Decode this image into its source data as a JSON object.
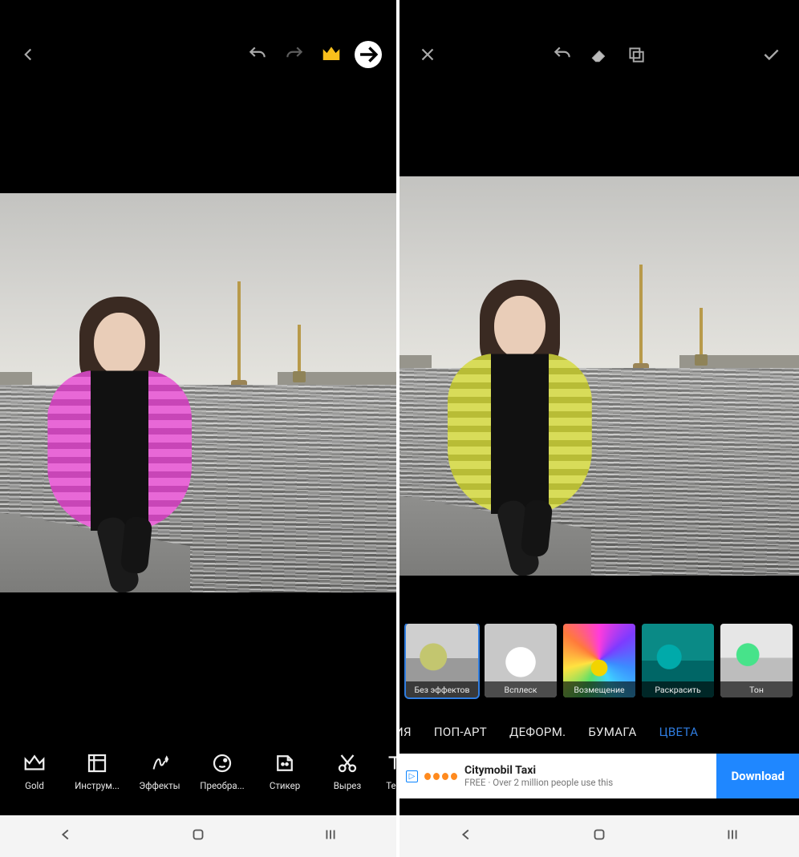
{
  "left": {
    "toolbar": {
      "back": "back",
      "undo": "undo",
      "redo": "redo",
      "crown": "crown",
      "next": "next"
    },
    "tools": [
      {
        "key": "gold",
        "label": "Gold"
      },
      {
        "key": "tools",
        "label": "Инструм..."
      },
      {
        "key": "effects",
        "label": "Эффекты"
      },
      {
        "key": "transform",
        "label": "Преобра..."
      },
      {
        "key": "sticker",
        "label": "Стикер"
      },
      {
        "key": "cutout",
        "label": "Вырез"
      },
      {
        "key": "text",
        "label": "Те..."
      }
    ]
  },
  "right": {
    "toolbar": {
      "close": "close",
      "undo": "undo",
      "eraser": "eraser",
      "layers": "layers",
      "apply": "apply"
    },
    "effects": [
      {
        "key": "none",
        "label": "Без эффектов",
        "selected": true
      },
      {
        "key": "splash",
        "label": "Всплеск"
      },
      {
        "key": "displace",
        "label": "Возмещение"
      },
      {
        "key": "colorize",
        "label": "Раскрасить"
      },
      {
        "key": "tone",
        "label": "Тон"
      }
    ],
    "categories": [
      {
        "key": "partial",
        "label": "ИЯ"
      },
      {
        "key": "popart",
        "label": "ПОП-АРТ"
      },
      {
        "key": "deform",
        "label": "ДЕФОРМ."
      },
      {
        "key": "paper",
        "label": "БУМАГА"
      },
      {
        "key": "colors",
        "label": "ЦВЕТА",
        "active": true
      }
    ],
    "ad": {
      "title": "Citymobil Taxi",
      "subtitle": "FREE · Over 2 million people use this",
      "cta": "Download"
    }
  }
}
